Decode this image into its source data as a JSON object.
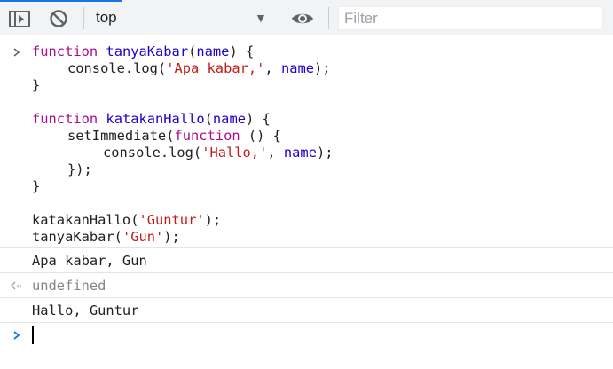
{
  "toolbar": {
    "context_value": "top",
    "filter_placeholder": "Filter",
    "icons": [
      "sidebar-toggle-icon",
      "clear-console-icon",
      "dropdown-caret-icon",
      "eye-icon"
    ]
  },
  "colors": {
    "keyword": "#aa0d91",
    "function_name": "#1c00cf",
    "string": "#c41a16",
    "accent": "#1a73e8",
    "muted": "#80868b"
  },
  "console": {
    "input_code": {
      "line1": {
        "kw": "function",
        "name": "tanyaKabar",
        "open": "(",
        "param": "name",
        "close": ") {"
      },
      "line2": {
        "pre": "console.log(",
        "str": "'Apa kabar,'",
        "mid": ", ",
        "param": "name",
        "post": ");"
      },
      "line3": "}",
      "line5": {
        "kw": "function",
        "name": "katakanHallo",
        "open": "(",
        "param": "name",
        "close": ") {"
      },
      "line6": {
        "pre": "setImmediate(",
        "kw": "function",
        "post": " () {"
      },
      "line7": {
        "pre": "console.log(",
        "str": "'Hallo,'",
        "mid": ", ",
        "param": "name",
        "post": ");"
      },
      "line8": "});",
      "line9": "}",
      "line11": {
        "pre": "katakanHallo(",
        "str": "'Guntur'",
        "post": ");"
      },
      "line12": {
        "pre": "tanyaKabar(",
        "str": "'Gun'",
        "post": ");"
      }
    },
    "log_output_1": "Apa kabar, Gun",
    "return_value": "undefined",
    "log_output_2": "Hallo, Guntur"
  }
}
